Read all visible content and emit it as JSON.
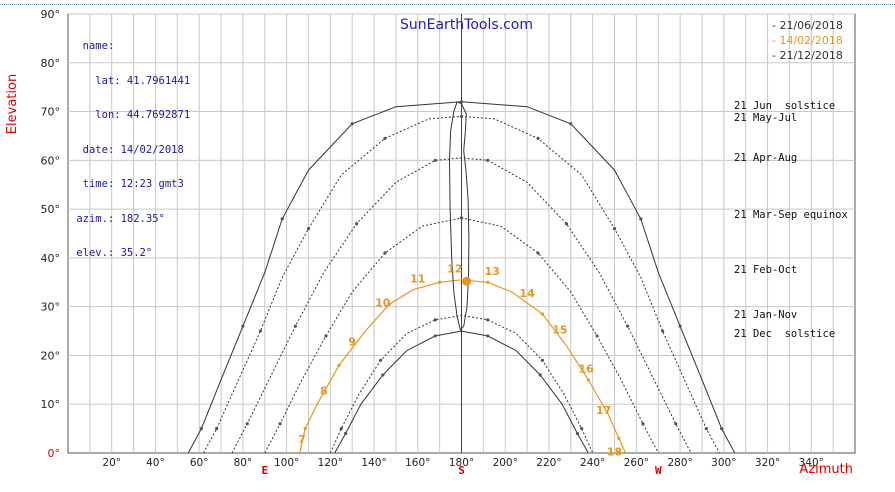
{
  "site_title": "SunEarthTools.com",
  "info": {
    "name_label": "name:",
    "lat_label": "lat:",
    "lat": "41.7961441",
    "lon_label": "lon:",
    "lon": "44.7692871",
    "date_label": "date:",
    "date": "14/02/2018",
    "time_label": "time:",
    "time": "12:23 gmt3",
    "azim_label": "azim.:",
    "azim": "182.35°",
    "elev_label": "elev.:",
    "elev": "35.2°"
  },
  "legend": [
    {
      "label": "21/06/2018",
      "color": "#333333"
    },
    {
      "label": "14/02/2018",
      "color": "#e8961e"
    },
    {
      "label": "21/12/2018",
      "color": "#333333"
    }
  ],
  "curve_labels": [
    {
      "text": "21 Jun  solstice",
      "elev": 71
    },
    {
      "text": "21 May-Jul",
      "elev": 68.5
    },
    {
      "text": "21 Apr-Aug",
      "elev": 60.3
    },
    {
      "text": "21 Mar-Sep equinox",
      "elev": 48.6
    },
    {
      "text": "21 Feb-Oct",
      "elev": 37.4
    },
    {
      "text": "21 Jan-Nov",
      "elev": 28.1
    },
    {
      "text": "21 Dec  solstice",
      "elev": 24.2
    }
  ],
  "colors": {
    "accent": "#e8961e",
    "axis_label": "#dd0000",
    "grid": "#c8c8c8",
    "curve": "#333333"
  },
  "chart_data": {
    "type": "line",
    "title": "SunEarthTools.com",
    "xlabel": "Azimuth",
    "ylabel": "Elevation",
    "xlim": [
      0,
      360
    ],
    "ylim": [
      0,
      90
    ],
    "x_ticks": [
      20,
      40,
      60,
      80,
      100,
      120,
      140,
      160,
      180,
      200,
      220,
      240,
      260,
      280,
      300,
      320,
      340
    ],
    "y_ticks": [
      0,
      10,
      20,
      30,
      40,
      50,
      60,
      70,
      80,
      90
    ],
    "compass": [
      {
        "label": "E",
        "az": 90
      },
      {
        "label": "S",
        "az": 180
      },
      {
        "label": "W",
        "az": 270
      }
    ],
    "grid": true,
    "series": [
      {
        "name": "21 Jun  solstice",
        "style": "solid",
        "points": [
          [
            55,
            0
          ],
          [
            61,
            5
          ],
          [
            70,
            15
          ],
          [
            80,
            26
          ],
          [
            90,
            37
          ],
          [
            98,
            48
          ],
          [
            110,
            58
          ],
          [
            130,
            67.5
          ],
          [
            150,
            71
          ],
          [
            180,
            72
          ],
          [
            210,
            71
          ],
          [
            230,
            67.5
          ],
          [
            250,
            58
          ],
          [
            262,
            48
          ],
          [
            270,
            37
          ],
          [
            280,
            26
          ],
          [
            290,
            15
          ],
          [
            299,
            5
          ],
          [
            305,
            0
          ]
        ]
      },
      {
        "name": "21 May-Jul",
        "style": "dotted",
        "points": [
          [
            62,
            0
          ],
          [
            68,
            5
          ],
          [
            78,
            15
          ],
          [
            88,
            25
          ],
          [
            98,
            36
          ],
          [
            110,
            46
          ],
          [
            125,
            57
          ],
          [
            145,
            64.5
          ],
          [
            165,
            68.5
          ],
          [
            180,
            69
          ],
          [
            195,
            68.5
          ],
          [
            215,
            64.5
          ],
          [
            235,
            57
          ],
          [
            250,
            46
          ],
          [
            262,
            36
          ],
          [
            272,
            25
          ],
          [
            282,
            15
          ],
          [
            292,
            5
          ],
          [
            298,
            0
          ]
        ]
      },
      {
        "name": "21 Apr-Aug",
        "style": "dotted",
        "points": [
          [
            75,
            0
          ],
          [
            82,
            6
          ],
          [
            93,
            16
          ],
          [
            104,
            26
          ],
          [
            117,
            37
          ],
          [
            132,
            47
          ],
          [
            150,
            55.5
          ],
          [
            168,
            60
          ],
          [
            180,
            60.5
          ],
          [
            192,
            60
          ],
          [
            210,
            55.5
          ],
          [
            228,
            47
          ],
          [
            243,
            37
          ],
          [
            256,
            26
          ],
          [
            267,
            16
          ],
          [
            278,
            6
          ],
          [
            285,
            0
          ]
        ]
      },
      {
        "name": "21 Mar-Sep equinox",
        "style": "dotted",
        "points": [
          [
            90,
            0
          ],
          [
            97,
            6
          ],
          [
            107,
            15
          ],
          [
            118,
            24
          ],
          [
            130,
            33
          ],
          [
            145,
            41
          ],
          [
            162,
            46.5
          ],
          [
            180,
            48.2
          ],
          [
            198,
            46.5
          ],
          [
            215,
            41
          ],
          [
            230,
            33
          ],
          [
            242,
            24
          ],
          [
            253,
            15
          ],
          [
            263,
            6
          ],
          [
            270,
            0
          ]
        ]
      },
      {
        "name": "21 Feb-Oct",
        "style": "orange",
        "points": [
          [
            106,
            0
          ],
          [
            108.5,
            5
          ],
          [
            114,
            10
          ],
          [
            124,
            18
          ],
          [
            136,
            25
          ],
          [
            147,
            30.5
          ],
          [
            158,
            33.5
          ],
          [
            170,
            35
          ],
          [
            180,
            35.5
          ],
          [
            192,
            35
          ],
          [
            203,
            33
          ],
          [
            217,
            28.5
          ],
          [
            228,
            22
          ],
          [
            238,
            15
          ],
          [
            247,
            8
          ],
          [
            252,
            3
          ],
          [
            255,
            0
          ]
        ]
      },
      {
        "name": "21 Jan-Nov",
        "style": "dotted",
        "points": [
          [
            120,
            0
          ],
          [
            125,
            5
          ],
          [
            133,
            12
          ],
          [
            143,
            19
          ],
          [
            155,
            24.5
          ],
          [
            168,
            27.3
          ],
          [
            180,
            28.2
          ],
          [
            192,
            27.3
          ],
          [
            205,
            24.5
          ],
          [
            217,
            19
          ],
          [
            227,
            12
          ],
          [
            235,
            5
          ],
          [
            240,
            0
          ]
        ]
      },
      {
        "name": "21 Dec  solstice",
        "style": "solid",
        "points": [
          [
            122,
            0
          ],
          [
            127,
            4
          ],
          [
            134,
            10
          ],
          [
            144,
            16
          ],
          [
            155,
            21
          ],
          [
            168,
            24
          ],
          [
            180,
            25
          ],
          [
            192,
            24
          ],
          [
            205,
            21
          ],
          [
            216,
            16
          ],
          [
            226,
            10
          ],
          [
            233,
            4
          ],
          [
            238,
            0
          ]
        ]
      }
    ],
    "analemma": {
      "name": "12 h",
      "points": [
        [
          178,
          72
        ],
        [
          176.5,
          70
        ],
        [
          175,
          66
        ],
        [
          174.5,
          60
        ],
        [
          174.8,
          50
        ],
        [
          175.5,
          40
        ],
        [
          176.5,
          33
        ],
        [
          178,
          28
        ],
        [
          179.5,
          25.2
        ],
        [
          181,
          26
        ],
        [
          182.5,
          30
        ],
        [
          183.2,
          36
        ],
        [
          183.4,
          44
        ],
        [
          183,
          52
        ],
        [
          182,
          58
        ],
        [
          181,
          62
        ],
        [
          181.8,
          66
        ],
        [
          182.2,
          69.5
        ],
        [
          180,
          71.6
        ],
        [
          178,
          72
        ]
      ]
    },
    "hour_points": [
      {
        "label": "7",
        "az": 107,
        "el": 2
      },
      {
        "label": "8",
        "az": 117,
        "el": 12
      },
      {
        "label": "9",
        "az": 130,
        "el": 22
      },
      {
        "label": "10",
        "az": 144,
        "el": 30
      },
      {
        "label": "11",
        "az": 160,
        "el": 35
      },
      {
        "label": "12",
        "az": 177,
        "el": 37
      },
      {
        "label": "13",
        "az": 194,
        "el": 36.5
      },
      {
        "label": "14",
        "az": 210,
        "el": 32
      },
      {
        "label": "15",
        "az": 225,
        "el": 24.5
      },
      {
        "label": "16",
        "az": 237,
        "el": 16.5
      },
      {
        "label": "17",
        "az": 245,
        "el": 8
      },
      {
        "label": "18",
        "az": 250,
        "el": -0.5
      }
    ],
    "current_sun": {
      "az": 182.35,
      "el": 35.2
    }
  }
}
